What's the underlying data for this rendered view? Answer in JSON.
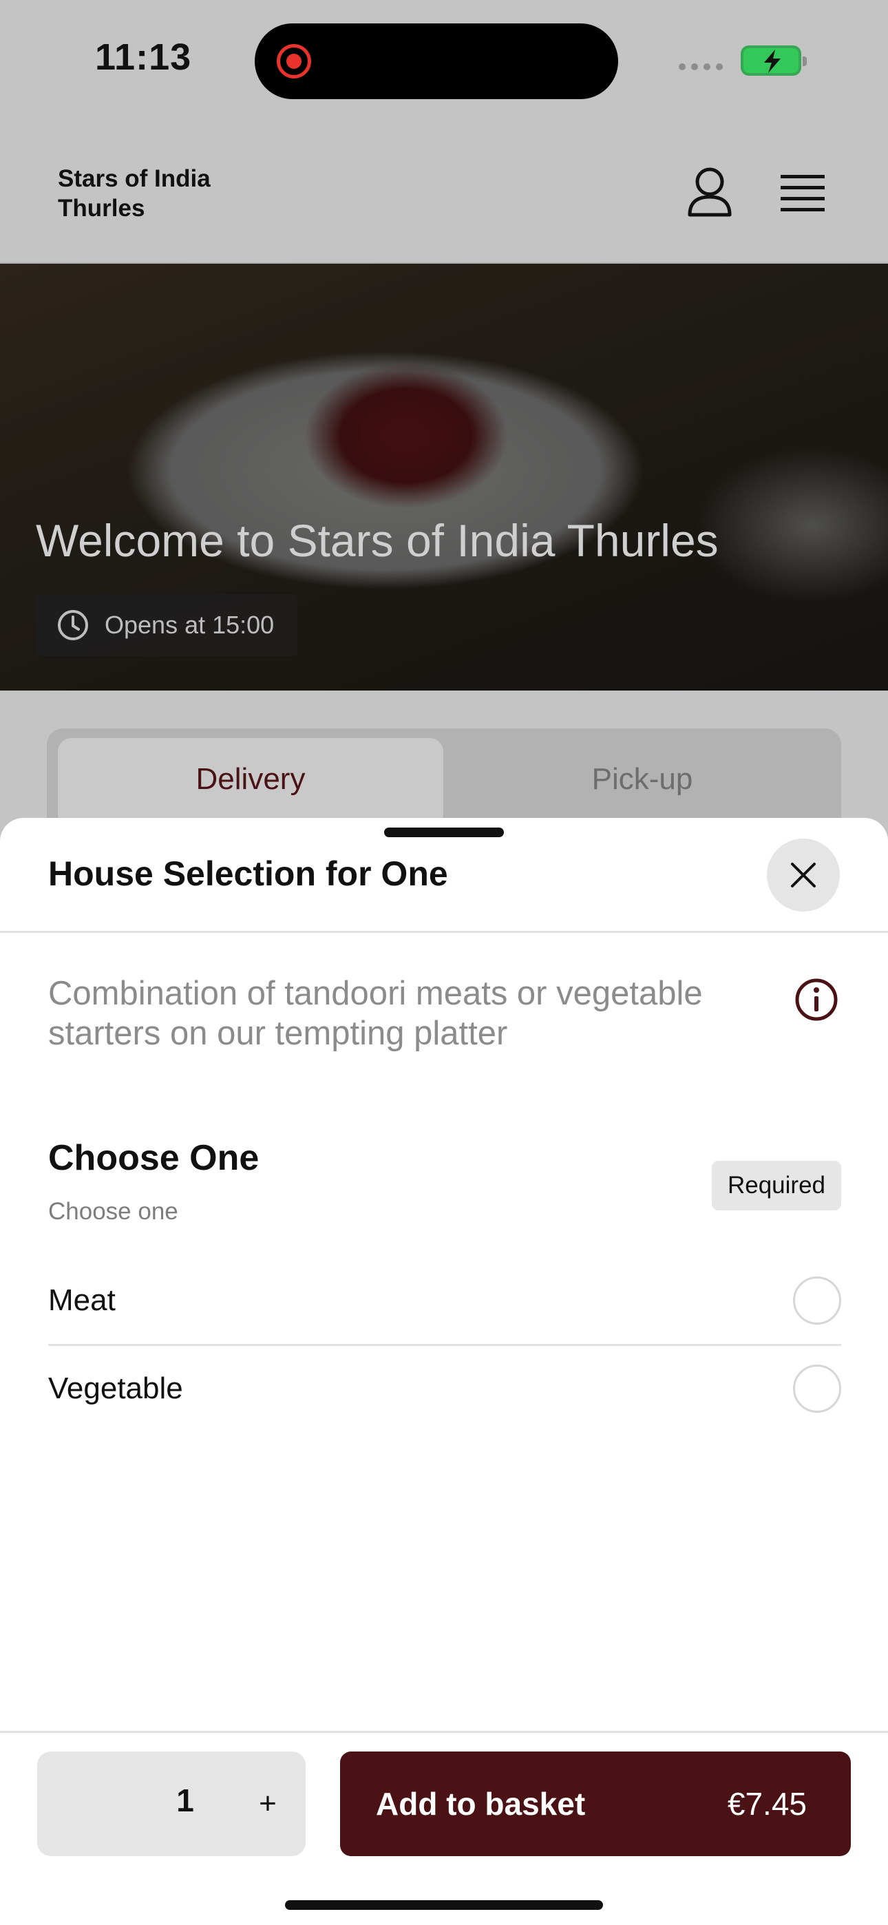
{
  "status_bar": {
    "time": "11:13"
  },
  "header": {
    "brand": "Stars of India Thurles",
    "icons": [
      "user-icon",
      "hamburger-menu-icon"
    ]
  },
  "hero": {
    "title": "Welcome to Stars of India Thurles",
    "hours": "Opens at 15:00",
    "hours_icon": "clock-icon"
  },
  "tabs": [
    {
      "label": "Delivery",
      "selected": true
    },
    {
      "label": "Pick-up",
      "selected": false
    }
  ],
  "sheet": {
    "title": "House Selection for One",
    "description": "Combination of tandoori meats or vegetable starters on our tempting platter",
    "group": {
      "title": "Choose One",
      "subtitle": "Choose one",
      "badge": "Required",
      "options": [
        {
          "label": "Meat",
          "selected": false
        },
        {
          "label": "Vegetable",
          "selected": false
        }
      ]
    }
  },
  "footer": {
    "quantity": "1",
    "plus": "+",
    "add_label": "Add to basket",
    "price": "€7.45"
  },
  "colors": {
    "accent": "#4a1214",
    "overlay_background": "#c4c4c4",
    "battery_green": "#34c759",
    "recording_red": "#e8332d"
  }
}
